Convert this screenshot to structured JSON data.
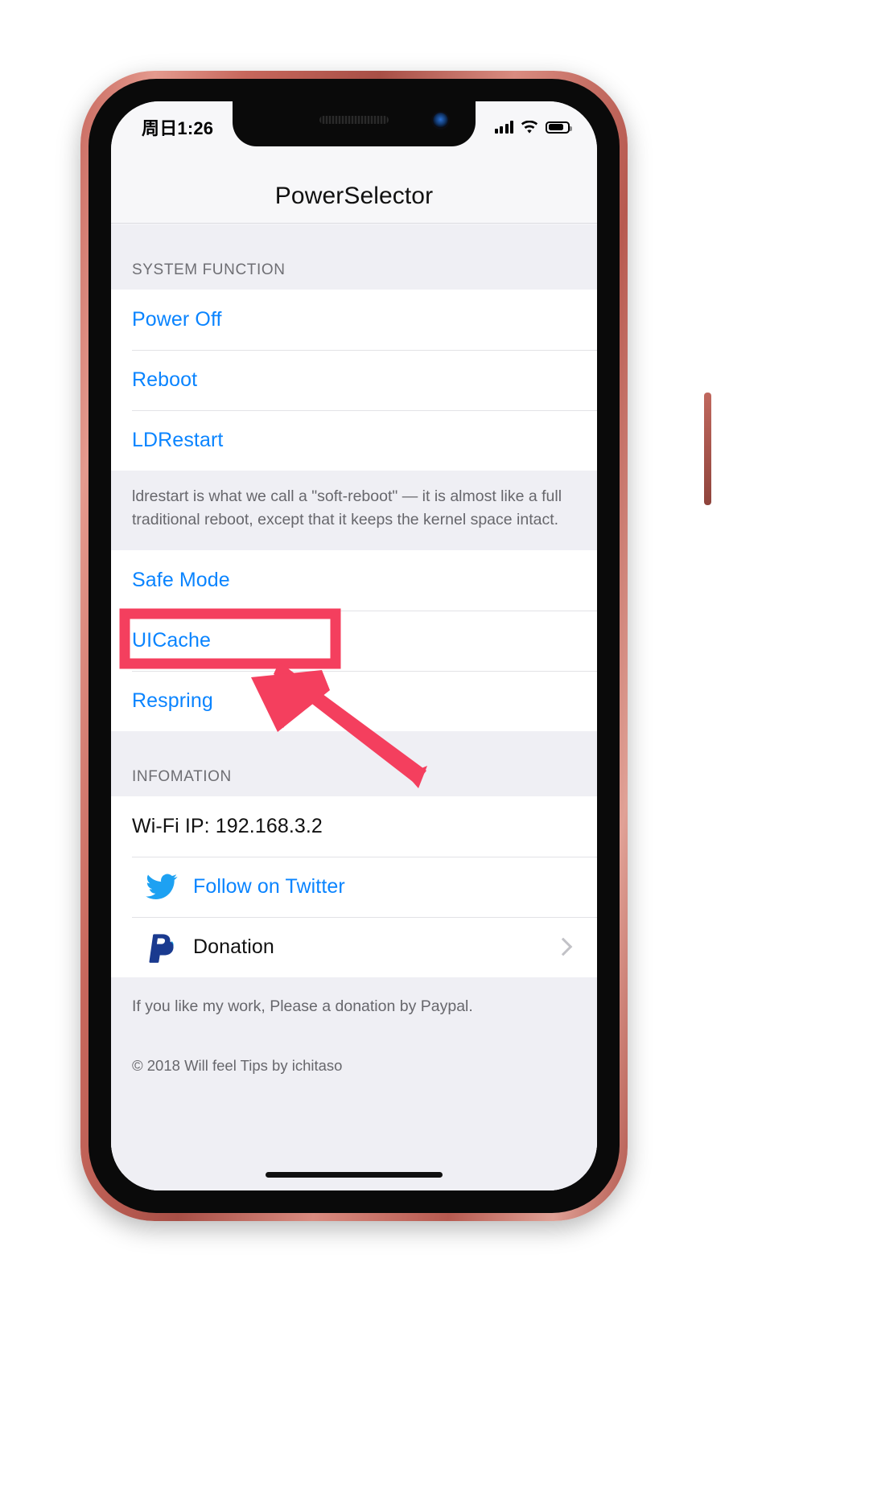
{
  "status_bar": {
    "time": "周日1:26",
    "signal_icon": "cellular-signal-icon",
    "wifi_icon": "wifi-icon",
    "battery_icon": "battery-icon"
  },
  "nav": {
    "title": "PowerSelector"
  },
  "sections": [
    {
      "header": "SYSTEM FUNCTION",
      "rows": [
        {
          "label": "Power Off",
          "style": "action"
        },
        {
          "label": "Reboot",
          "style": "action"
        },
        {
          "label": "LDRestart",
          "style": "action"
        }
      ],
      "footer": "ldrestart is what we call a \"soft-reboot\" — it is almost like a full traditional reboot, except that it keeps the kernel space intact."
    },
    {
      "header": "",
      "rows": [
        {
          "label": "Safe Mode",
          "style": "action"
        },
        {
          "label": "UICache",
          "style": "action"
        },
        {
          "label": "Respring",
          "style": "action"
        }
      ],
      "footer": ""
    },
    {
      "header": "INFOMATION",
      "rows": [
        {
          "label": "Wi-Fi IP: 192.168.3.2",
          "style": "plain"
        },
        {
          "label": "Follow on Twitter",
          "style": "action",
          "icon": "twitter-icon"
        },
        {
          "label": "Donation",
          "style": "plain",
          "icon": "paypal-icon",
          "accessory": "chevron-right-icon"
        }
      ],
      "footer": "If you like my work, Please a donation by Paypal."
    }
  ],
  "copyright": "© 2018 Will feel Tips by ichitaso",
  "annotation": {
    "highlight_target": "UICache",
    "color": "#f43f5e",
    "arrow": "arrow-pointing-to-uicache"
  },
  "colors": {
    "accent_blue": "#0a84ff",
    "twitter_blue": "#1da1f2",
    "paypal_blue": "#1a3a8f",
    "annotation_red": "#f43f5e",
    "group_bg": "#efeff4"
  }
}
